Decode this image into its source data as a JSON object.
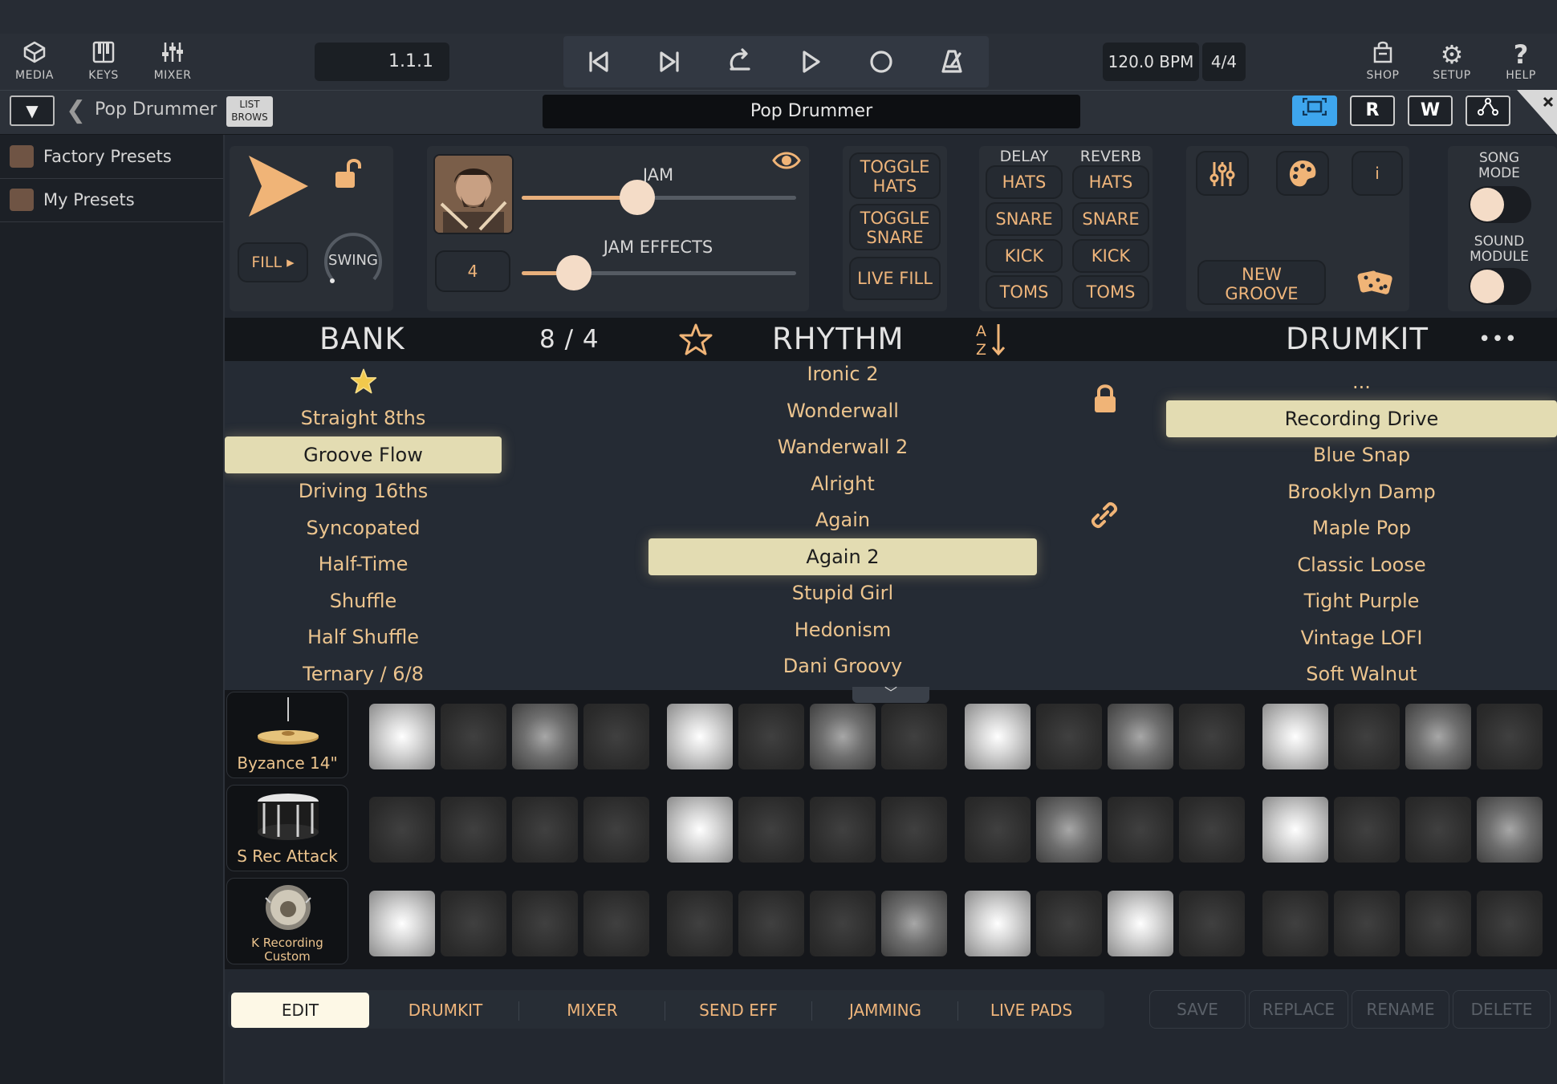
{
  "toolbar": {
    "left_buttons": [
      {
        "label": "MEDIA",
        "icon": "media-cube-icon"
      },
      {
        "label": "KEYS",
        "icon": "keys-piano-icon"
      },
      {
        "label": "MIXER",
        "icon": "mixer-faders-icon"
      }
    ],
    "position": "1.1.1",
    "transport": [
      "skip-start-icon",
      "skip-next-icon",
      "loop-icon",
      "play-icon",
      "record-icon",
      "metronome-icon"
    ],
    "bpm": "120.0 BPM",
    "time_signature": "4/4",
    "right_buttons": [
      {
        "label": "SHOP",
        "icon": "shop-bag-icon"
      },
      {
        "label": "SETUP",
        "icon": "gear-icon"
      },
      {
        "label": "HELP",
        "icon": "question-icon"
      }
    ]
  },
  "nav": {
    "breadcrumb": "Pop Drummer",
    "list_browse_line1": "LIST",
    "list_browse_line2": "BROWS",
    "title": "Pop Drummer",
    "buttons": [
      "R",
      "W"
    ],
    "accent_color": "#3ea6ee"
  },
  "sidebar": {
    "items": [
      {
        "label": "Factory Presets"
      },
      {
        "label": "My Presets"
      }
    ]
  },
  "controls": {
    "fill_label": "FILL ▸",
    "swing_label": "SWING",
    "jam_label": "JAM",
    "jam_value": 0.42,
    "jam_effects_label": "JAM EFFECTS",
    "jam_effects_value": 0.19,
    "complexity_value": "4",
    "toggle_hats": [
      "TOGGLE",
      "HATS"
    ],
    "toggle_snare": [
      "TOGGLE",
      "SNARE"
    ],
    "live_fill": "LIVE FILL",
    "delay_label": "DELAY",
    "reverb_label": "REVERB",
    "fx_parts": [
      "HATS",
      "SNARE",
      "KICK",
      "TOMS"
    ],
    "new_groove": [
      "NEW",
      "GROOVE"
    ],
    "info_label": "i",
    "song_mode": [
      "SONG",
      "MODE"
    ],
    "sound_module": [
      "SOUND",
      "MODULE"
    ]
  },
  "browser": {
    "bank_title": "BANK",
    "count": "8 / 4",
    "rhythm_title": "RHYTHM",
    "drumkit_title": "DRUMKIT",
    "more": "•••",
    "sort_icon": "sort-az-icon",
    "bank_items": [
      "Straight 8ths",
      "Groove Flow",
      "Driving 16ths",
      "Syncopated",
      "Half-Time",
      "Shuffle",
      "Half Shuffle",
      "Ternary / 6/8"
    ],
    "bank_selected": "Groove Flow",
    "rhythm_items": [
      "Ironic 2",
      "Wonderwall",
      "Wanderwall 2",
      "Alright",
      "Again",
      "Again 2",
      "Stupid Girl",
      "Hedonism",
      "Dani Groovy"
    ],
    "rhythm_selected": "Again 2",
    "drumkit_items": [
      "...",
      "Recording Drive",
      "Blue Snap",
      "Brooklyn Damp",
      "Maple Pop",
      "Classic Loose",
      "Tight Purple",
      "Vintage LOFI",
      "Soft Walnut"
    ],
    "drumkit_selected": "Recording Drive",
    "list_color": "#ecc48e",
    "selected_bg": "#e3dcb2"
  },
  "pattern": {
    "instruments": [
      {
        "name": "Byzance 14\"",
        "icon": "cymbal-icon"
      },
      {
        "name": "S Rec Attack",
        "icon": "snare-drum-icon"
      },
      {
        "name": "K Recording Custom",
        "icon": "kick-drum-icon"
      }
    ],
    "rows": [
      [
        "on",
        "off",
        "mid",
        "off",
        "on",
        "off",
        "mid",
        "off",
        "on",
        "off",
        "mid",
        "off",
        "on",
        "off",
        "mid",
        "off"
      ],
      [
        "off",
        "off",
        "off",
        "off",
        "on",
        "off",
        "off",
        "off",
        "off",
        "mid",
        "off",
        "off",
        "on",
        "off",
        "off",
        "mid"
      ],
      [
        "on",
        "off",
        "off",
        "off",
        "off",
        "off",
        "off",
        "mid",
        "on",
        "off",
        "on",
        "off",
        "off",
        "off",
        "off",
        "off"
      ]
    ]
  },
  "tabs": {
    "items": [
      "EDIT",
      "DRUMKIT",
      "MIXER",
      "SEND EFF",
      "JAMMING",
      "LIVE PADS"
    ],
    "active": "EDIT",
    "actions": [
      "SAVE",
      "REPLACE",
      "RENAME",
      "DELETE"
    ]
  }
}
